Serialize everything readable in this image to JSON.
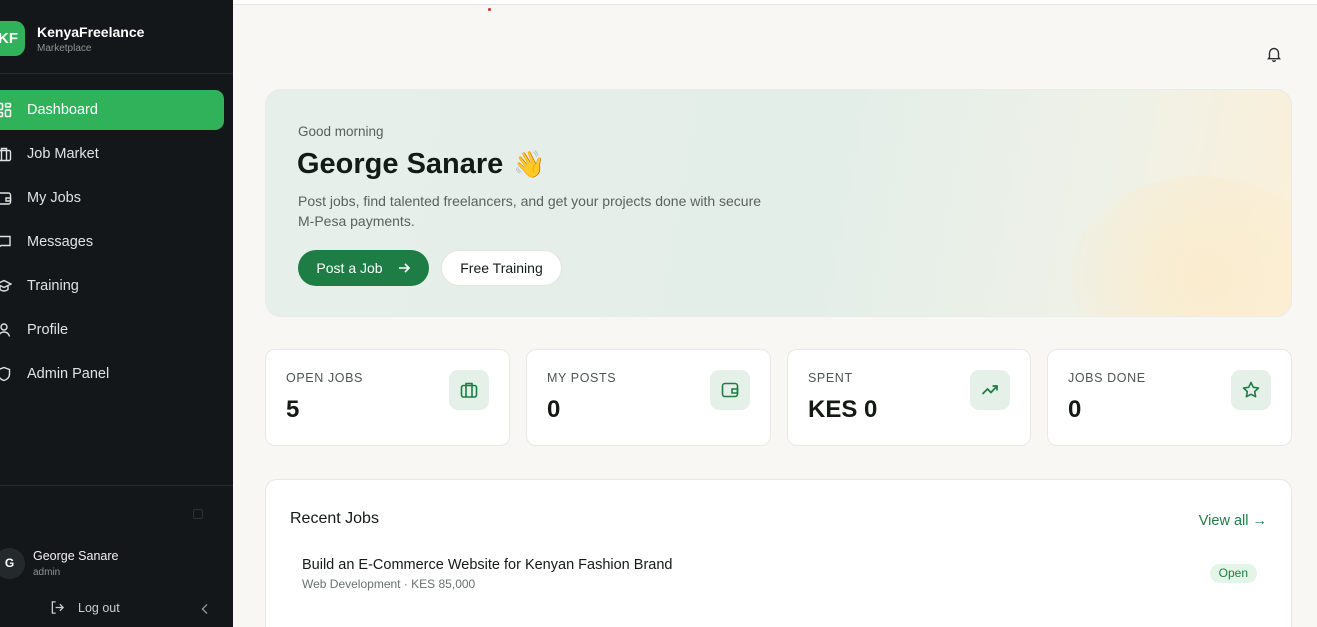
{
  "brand": {
    "logo_text": "KF",
    "name": "KenyaFreelance",
    "subtitle": "Marketplace"
  },
  "sidebar": {
    "items": [
      {
        "label": "Dashboard",
        "icon": "dashboard-grid-icon",
        "active": true
      },
      {
        "label": "Job Market",
        "icon": "briefcase-icon"
      },
      {
        "label": "My Jobs",
        "icon": "wallet-icon"
      },
      {
        "label": "Messages",
        "icon": "message-square-icon"
      },
      {
        "label": "Training",
        "icon": "graduation-cap-icon"
      },
      {
        "label": "Profile",
        "icon": "user-icon"
      },
      {
        "label": "Admin Panel",
        "icon": "shield-icon"
      }
    ],
    "user": {
      "initial": "G",
      "name": "George Sanare",
      "role": "admin"
    },
    "logout_label": "Log out"
  },
  "hero": {
    "greeting": "Good morning",
    "name": "George Sanare",
    "emoji": "👋",
    "description": "Post jobs, find talented freelancers, and get your projects done with secure M-Pesa payments.",
    "primary_button": "Post a Job",
    "secondary_button": "Free Training"
  },
  "stats": [
    {
      "label": "OPEN JOBS",
      "value": "5",
      "icon": "briefcase-icon"
    },
    {
      "label": "MY POSTS",
      "value": "0",
      "icon": "wallet-icon"
    },
    {
      "label": "SPENT",
      "value": "KES 0",
      "icon": "trending-up-icon"
    },
    {
      "label": "JOBS DONE",
      "value": "0",
      "icon": "star-icon"
    }
  ],
  "recent_jobs": {
    "title": "Recent Jobs",
    "view_all": "View all →",
    "items": [
      {
        "title": "Build an E-Commerce Website for Kenyan Fashion Brand",
        "meta": "Web Development · KES 85,000",
        "status": "Open"
      }
    ]
  },
  "colors": {
    "accent": "#2fb25a",
    "primary_dark": "#1d7d44",
    "sidebar_bg": "#131719",
    "page_bg": "#f8f7f4"
  }
}
